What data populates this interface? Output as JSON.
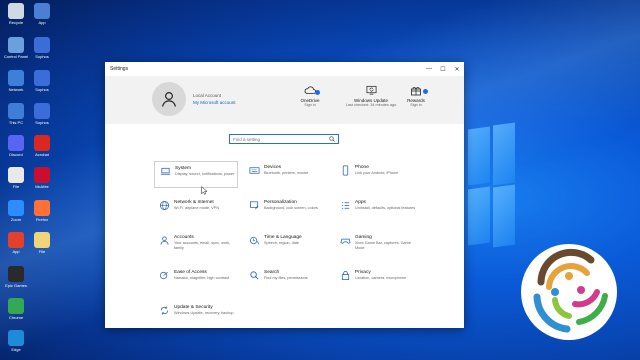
{
  "desktop": {
    "icons": [
      {
        "label": "Recycle",
        "color": "#cfd8e3"
      },
      {
        "label": "App",
        "color": "#4a7fd1"
      },
      {
        "label": "Control Panel",
        "color": "#6aa0e0"
      },
      {
        "label": "Sophos",
        "color": "#3b6dd8"
      },
      {
        "label": "Network",
        "color": "#3d80d9"
      },
      {
        "label": "Sophos",
        "color": "#3b6dd8"
      },
      {
        "label": "This PC",
        "color": "#3d7fd6"
      },
      {
        "label": "Sophos",
        "color": "#3b6dd8"
      },
      {
        "label": "Discord",
        "color": "#5865f2"
      },
      {
        "label": "Acrobat",
        "color": "#d9281f"
      },
      {
        "label": "File",
        "color": "#e9e9e9"
      },
      {
        "label": "McAfee",
        "color": "#c8102e"
      },
      {
        "label": "Zoom",
        "color": "#2d8cff"
      },
      {
        "label": "Firefox",
        "color": "#ff7139"
      },
      {
        "label": "App",
        "color": "#e5402a"
      },
      {
        "label": "File",
        "color": "#f0d47a"
      },
      {
        "label": "Epic Games",
        "color": "#2a2a2a"
      },
      {
        "label": "Chrome",
        "color": "#34a853"
      },
      {
        "label": "Edge",
        "color": "#1e8bd6"
      }
    ]
  },
  "window": {
    "title": "Settings",
    "controls": {
      "minimize": "—",
      "maximize": "☐",
      "close": "✕"
    },
    "account": {
      "name": "Local Account",
      "link": "My Microsoft account"
    },
    "header_items": [
      {
        "title": "OneDrive",
        "sub": "Sign in",
        "icon": "cloud-icon"
      },
      {
        "title": "Windows Update",
        "sub": "Last checked: 34 minutes ago",
        "icon": "update-icon"
      },
      {
        "title": "Rewards",
        "sub": "Sign in",
        "icon": "rewards-icon"
      }
    ],
    "search": {
      "placeholder": "Find a setting"
    },
    "categories": [
      {
        "title": "System",
        "desc": "Display, sound, notifications, power",
        "icon": "laptop-icon"
      },
      {
        "title": "Devices",
        "desc": "Bluetooth, printers, mouse",
        "icon": "keyboard-icon"
      },
      {
        "title": "Phone",
        "desc": "Link your Android, iPhone",
        "icon": "phone-icon"
      },
      {
        "title": "Network & Internet",
        "desc": "Wi-Fi, airplane mode, VPN",
        "icon": "globe-icon"
      },
      {
        "title": "Personalization",
        "desc": "Background, lock screen, colors",
        "icon": "brush-icon"
      },
      {
        "title": "Apps",
        "desc": "Uninstall, defaults, optional features",
        "icon": "apps-icon"
      },
      {
        "title": "Accounts",
        "desc": "Your accounts, email, sync, work, family",
        "icon": "person-icon"
      },
      {
        "title": "Time & Language",
        "desc": "Speech, region, date",
        "icon": "clock-icon"
      },
      {
        "title": "Gaming",
        "desc": "Xbox Game Bar, captures, Game Mode",
        "icon": "gamepad-icon"
      },
      {
        "title": "Ease of Access",
        "desc": "Narrator, magnifier, high contrast",
        "icon": "ease-icon"
      },
      {
        "title": "Search",
        "desc": "Find my files, permissions",
        "icon": "search-icon"
      },
      {
        "title": "Privacy",
        "desc": "Location, camera, microphone",
        "icon": "lock-icon"
      },
      {
        "title": "Update & Security",
        "desc": "Windows Update, recovery, backup",
        "icon": "sync-icon"
      }
    ]
  }
}
